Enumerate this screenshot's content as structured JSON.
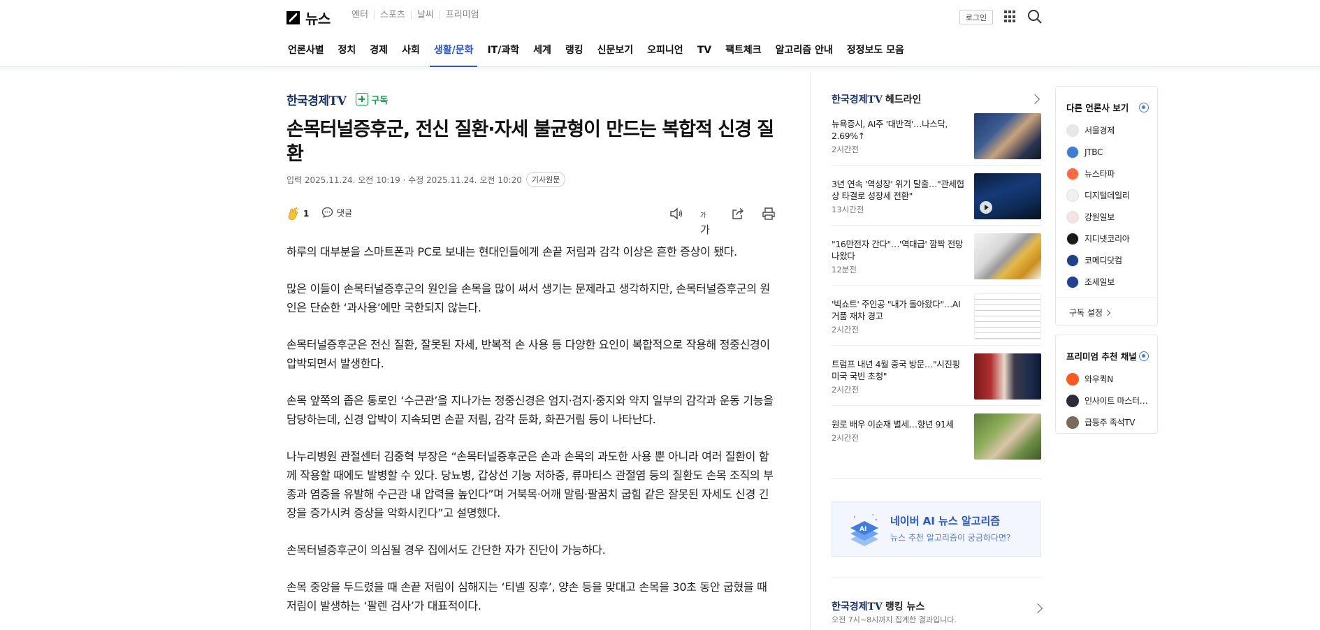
{
  "header": {
    "logo_text": "뉴스",
    "service_links": [
      "엔터",
      "스포츠",
      "날씨",
      "프리미엄"
    ],
    "login_label": "로그인"
  },
  "nav": {
    "items": [
      "언론사별",
      "정치",
      "경제",
      "사회",
      "생활/문화",
      "IT/과학",
      "세계",
      "랭킹",
      "신문보기",
      "오피니언",
      "TV",
      "팩트체크",
      "알고리즘 안내",
      "정정보도 모음"
    ],
    "active": "생활/문화"
  },
  "article": {
    "press": "한국경제TV",
    "subscribe_label": "구독",
    "headline": "손목터널증후군, 전신 질환·자세 불균형이 만드는 복합적 신경 질환",
    "meta": "입력 2025.11.24. 오전 10:19 · 수정 2025.11.24. 오전 10:20",
    "original_label": "기사원문",
    "reaction_count": "1",
    "comment_label": "댓글",
    "font_size_label": "가",
    "paragraphs": [
      "하루의 대부분을 스마트폰과 PC로 보내는 현대인들에게 손끝 저림과 감각 이상은 흔한 증상이 됐다.",
      "많은 이들이 손목터널증후군의 원인을 손목을 많이 써서 생기는 문제라고 생각하지만, 손목터널증후군의 원인은 단순한 ‘과사용’에만 국한되지 않는다.",
      "손목터널증후군은 전신 질환, 잘못된 자세, 반복적 손 사용 등 다양한 요인이 복합적으로 작용해 정중신경이 압박되면서 발생한다.",
      "손목 앞쪽의 좁은 통로인 ‘수근관’을 지나가는 정중신경은 엄지·검지·중지와 약지 일부의 감각과 운동 기능을 담당하는데, 신경 압박이 지속되면 손끝 저림, 감각 둔화, 화끈거림 등이 나타난다.",
      "나누리병원 관절센터 김중혁 부장은 “손목터널증후군은 손과 손목의 과도한 사용 뿐 아니라 여러 질환이 함께 작용할 때에도 발병할 수 있다. 당뇨병, 갑상선 기능 저하증, 류마티스 관절염 등의 질환도 손목 조직의 부종과 염증을 유발해 수근관 내 압력을 높인다”며 거북목·어깨 말림·팔꿈치 굽힘 같은 잘못된 자세도 신경 긴장을 증가시켜 증상을 악화시킨다”고 설명했다.",
      "손목터널증후군이 의심될 경우 집에서도 간단한 자가 진단이 가능하다.",
      "손목 중앙을 두드렸을 때 손끝 저림이 심해지는 ‘티넬 징후’, 양손 등을 맞대고 손목을 30초 동안 굽혔을 때 저림이 발생하는 ‘팔렌 검사’가 대표적이다."
    ]
  },
  "headlines": {
    "press": "한국경제TV",
    "title": "헤드라인",
    "items": [
      {
        "title": "뉴욕증시, AI주 '대반격'…나스닥, 2.69%↑",
        "time": "2시간전"
      },
      {
        "title": "3년 연속 '역성장' 위기 탈출…\"관세협상 타결로 성장세 전환\"",
        "time": "13시간전"
      },
      {
        "title": "\"16만전자 간다\"…'역대급' 깜짝 전망 나왔다",
        "time": "12분전"
      },
      {
        "title": "'빅쇼트' 주인공 \"내가 돌아왔다\"…AI 거품 재차 경고",
        "time": "2시간전"
      },
      {
        "title": "트럼프 내년 4월 중국 방문…\"시진핑 미국 국빈 초청\"",
        "time": "2시간전"
      },
      {
        "title": "원로 배우 이순재 별세…향년 91세",
        "time": "2시간전"
      }
    ]
  },
  "ai_promo": {
    "title": "네이버 AI 뉴스 알고리즘",
    "subtitle": "뉴스 추천 알고리즘이 궁금하다면?"
  },
  "ranking": {
    "press": "한국경제TV",
    "title": "랭킹 뉴스",
    "subtitle": "오전 7시~8시까지 집계한 결과입니다."
  },
  "other_press": {
    "title": "다른 언론사 보기",
    "items": [
      {
        "name": "서울경제",
        "color": "#e8e8e8"
      },
      {
        "name": "JTBC",
        "color": "#3b7dd8"
      },
      {
        "name": "뉴스타파",
        "color": "#ff6a3d"
      },
      {
        "name": "디지털데일리",
        "color": "#f0f0f0"
      },
      {
        "name": "강원일보",
        "color": "#f4e4e4"
      },
      {
        "name": "지디넷코리아",
        "color": "#1a1a1a"
      },
      {
        "name": "코메디닷컴",
        "color": "#1f3f8a"
      },
      {
        "name": "조세일보",
        "color": "#23408e"
      }
    ],
    "setting_label": "구독 설정"
  },
  "premium": {
    "title": "프리미엄 추천 채널",
    "items": [
      {
        "name": "와우퀵N",
        "color": "#ff5a1f"
      },
      {
        "name": "인사이트 마스터…",
        "color": "#2d2d3a"
      },
      {
        "name": "급등주 족석TV",
        "color": "#7a6a5a"
      }
    ]
  }
}
